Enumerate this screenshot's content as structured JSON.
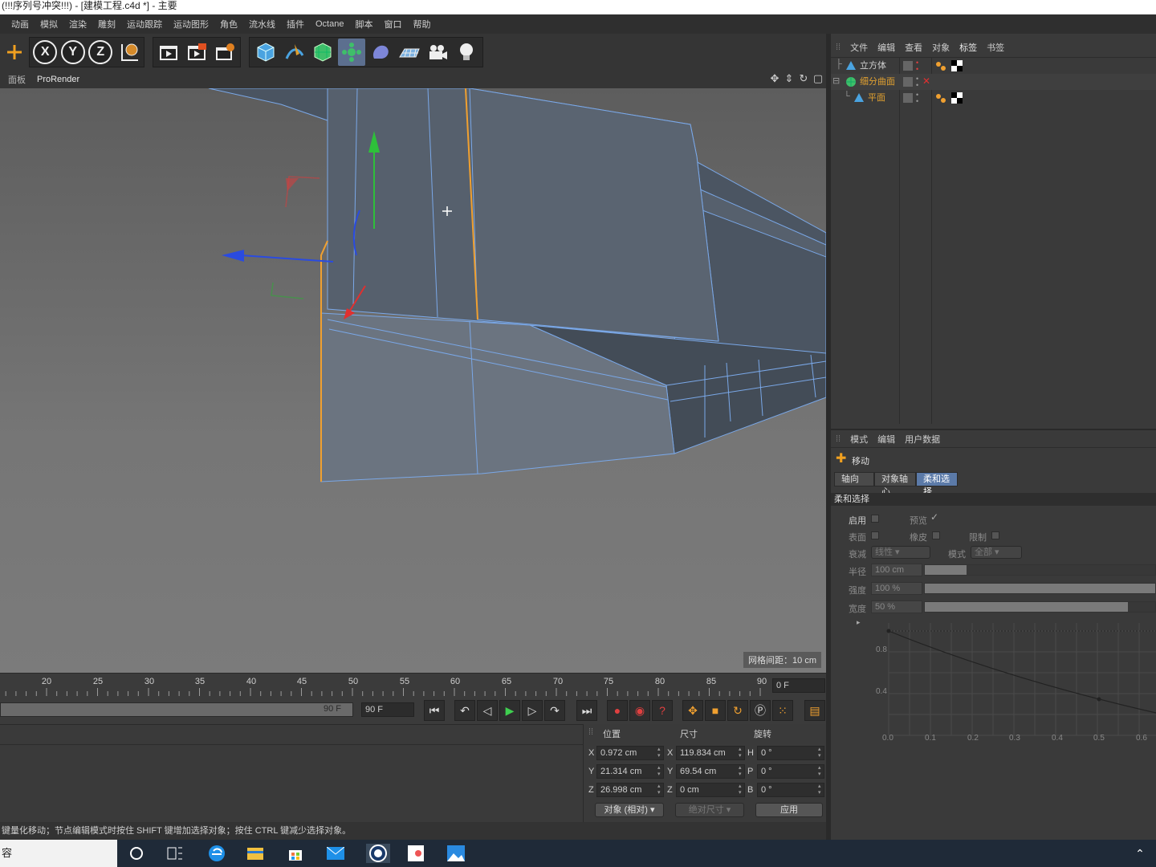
{
  "window": {
    "title": "(!!!序列号冲突!!!) - [建模工程.c4d *] - 主要"
  },
  "menu": [
    "动画",
    "模拟",
    "渲染",
    "雕刻",
    "运动跟踪",
    "运动图形",
    "角色",
    "流水线",
    "插件",
    "Octane",
    "脚本",
    "窗口",
    "帮助"
  ],
  "toolbar": {
    "axis_x": "X",
    "axis_y": "Y",
    "axis_z": "Z",
    "icons": [
      "move-icon",
      "lock-x-icon",
      "lock-y-icon",
      "lock-z-icon",
      "coordinate-system-icon",
      "render-view-icon",
      "render-picture-viewer-icon",
      "render-settings-icon",
      "cube-icon",
      "pen-icon",
      "subdivision-icon",
      "cloner-icon",
      "deformer-icon",
      "floor-icon",
      "camera-icon",
      "light-icon"
    ]
  },
  "viewport": {
    "tabs": [
      "面板",
      "ProRender"
    ],
    "grid_spacing": "网格间距：10 cm"
  },
  "timeline": {
    "ticks": [
      "20",
      "25",
      "30",
      "35",
      "40",
      "45",
      "50",
      "55",
      "60",
      "65",
      "70",
      "75",
      "80",
      "85",
      "90"
    ],
    "current_frame": "0 F",
    "end_frame_slider": "90 F",
    "end_frame_field": "90 F"
  },
  "coordinates": {
    "headers": {
      "position": "位置",
      "size": "尺寸",
      "rotation": "旋转"
    },
    "rows": [
      {
        "axis": "X",
        "pos": "0.972 cm",
        "size_axis": "X",
        "size": "119.834 cm",
        "rot_axis": "H",
        "rot": "0 °"
      },
      {
        "axis": "Y",
        "pos": "21.314 cm",
        "size_axis": "Y",
        "size": "69.54 cm",
        "rot_axis": "P",
        "rot": "0 °"
      },
      {
        "axis": "Z",
        "pos": "26.998 cm",
        "size_axis": "Z",
        "size": "0 cm",
        "rot_axis": "B",
        "rot": "0 °"
      }
    ],
    "mode": "对象 (相对)",
    "size_mode": "绝对尺寸",
    "apply": "应用"
  },
  "status": {
    "text": "键量化移动；节点编辑模式时按住 SHIFT 键增加选择对象；按住 CTRL 键减少选择对象。"
  },
  "object_manager": {
    "menu": [
      "文件",
      "编辑",
      "查看",
      "对象",
      "标签",
      "书签"
    ],
    "objects": [
      {
        "name": "立方体",
        "color": "#cfcfcf"
      },
      {
        "name": "细分曲面",
        "color": "#e0a030"
      },
      {
        "name": "平面",
        "color": "#e0a030"
      }
    ]
  },
  "attribute_manager": {
    "menu": [
      "模式",
      "编辑",
      "用户数据"
    ],
    "tool_name": "移动",
    "tabs": [
      "轴向",
      "对象轴心",
      "柔和选择"
    ],
    "section": "柔和选择",
    "props": {
      "enable": "启用",
      "preview": "预览",
      "surface": "表面",
      "rubber": "橡皮",
      "restrict": "限制",
      "falloff": "衰减",
      "falloff_value": "线性",
      "mode": "模式",
      "mode_value": "全部",
      "radius": "半径",
      "radius_value": "100 cm",
      "strength": "强度",
      "strength_value": "100 %",
      "width": "宽度",
      "width_value": "50 %"
    },
    "levels": {
      "radius": 0.18,
      "strength": 1.0,
      "width": 0.88
    },
    "graph": {
      "y_ticks": [
        "0.8",
        "0.4"
      ],
      "x_ticks": [
        "0.0",
        "0.1",
        "0.2",
        "0.3",
        "0.4",
        "0.5",
        "0.6"
      ]
    }
  },
  "taskbar": {
    "search_text": "容"
  }
}
